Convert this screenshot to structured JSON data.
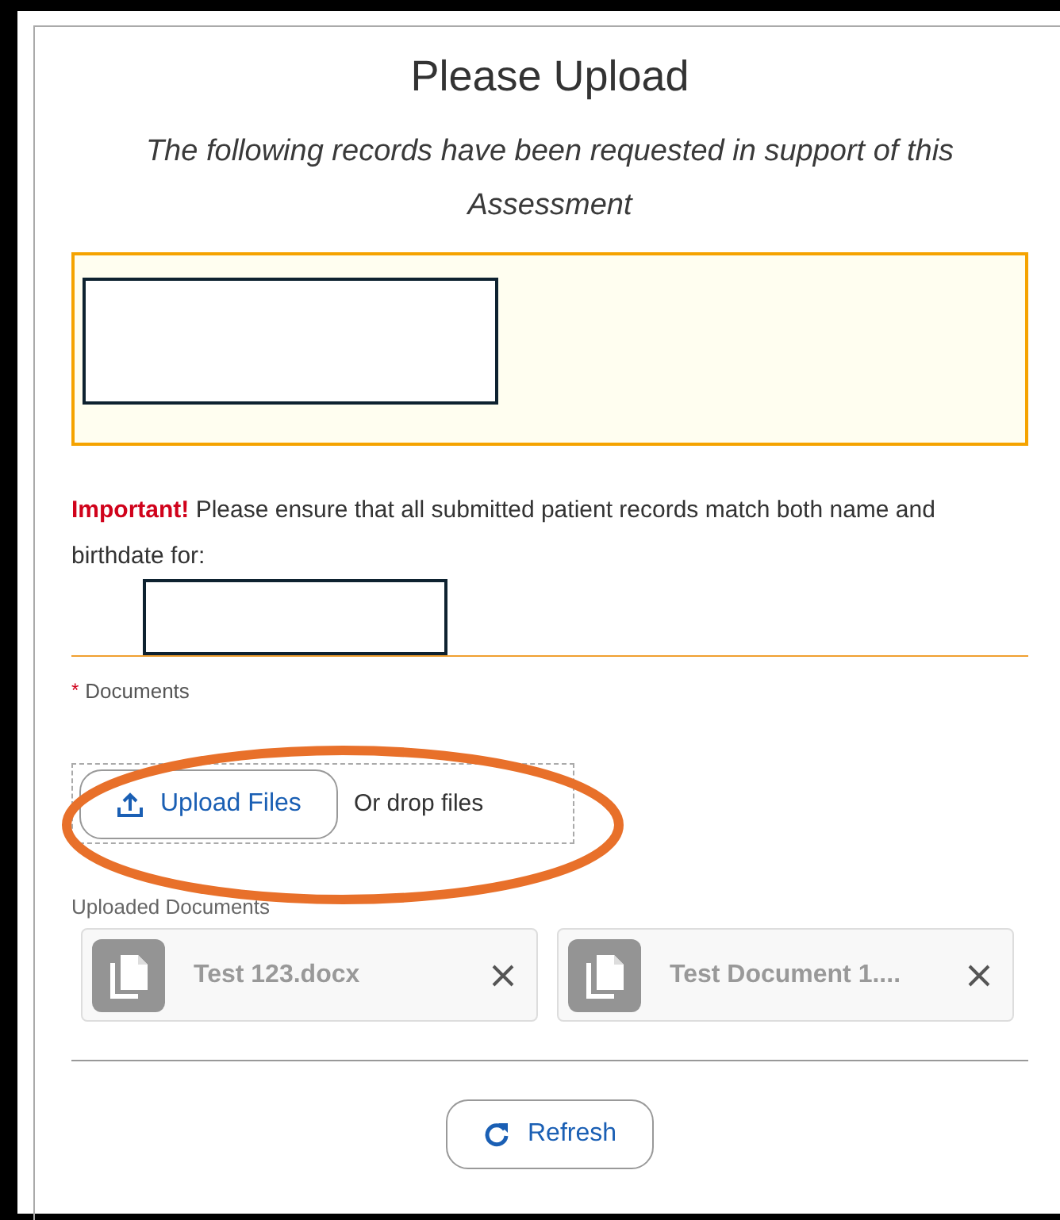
{
  "title": "Please Upload",
  "subtitle": "The following records have been requested in support of this Assessment",
  "notice": {
    "text": "**Important!** Please ensure that all submitted patient records match both name and birthdate for:"
  },
  "documents_field": {
    "label": "Documents",
    "required": true,
    "required_mark": "*",
    "upload_button": "Upload Files",
    "drop_text": "Or drop files"
  },
  "uploaded_label": "Uploaded Documents",
  "files": [
    {
      "name": "Test 123.docx"
    },
    {
      "name": "Test Document 1...."
    }
  ],
  "refresh_button": "Refresh"
}
